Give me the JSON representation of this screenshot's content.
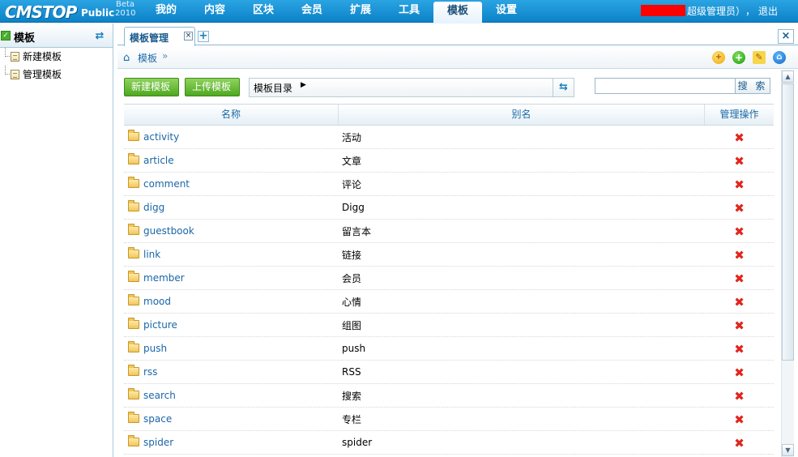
{
  "app": {
    "logo_text": "CMSTOP",
    "logo_edition": "Public",
    "logo_beta": "Beta",
    "logo_year": "2010"
  },
  "nav": {
    "tabs": [
      "我的",
      "内容",
      "区块",
      "会员",
      "扩展",
      "工具",
      "模板",
      "设置"
    ],
    "active_tab": "模板"
  },
  "user": {
    "role_text": "超级管理员）",
    "separator": "，",
    "logout_label": "退出"
  },
  "sidebar": {
    "title": "模板",
    "refresh_icon": "refresh-icon",
    "items": [
      {
        "label": "新建模板",
        "icon": "document-icon"
      },
      {
        "label": "管理模板",
        "icon": "document-icon"
      }
    ]
  },
  "tabs": {
    "active_label": "模板管理",
    "close_symbol": "×",
    "add_symbol": "+",
    "panel_close_symbol": "×"
  },
  "breadcrumb": {
    "home_icon": "home-icon",
    "label": "模板",
    "separator": "»"
  },
  "toolbar": {
    "new_label": "新建模板",
    "upload_label": "上传模板",
    "dir_label": "模板目录",
    "search_value": "",
    "search_label": "搜 索"
  },
  "table": {
    "headers": [
      "名称",
      "别名",
      "管理操作"
    ],
    "rows": [
      {
        "name": "activity",
        "alias": "活动"
      },
      {
        "name": "article",
        "alias": "文章"
      },
      {
        "name": "comment",
        "alias": "评论"
      },
      {
        "name": "digg",
        "alias": "Digg"
      },
      {
        "name": "guestbook",
        "alias": "留言本"
      },
      {
        "name": "link",
        "alias": "链接"
      },
      {
        "name": "member",
        "alias": "会员"
      },
      {
        "name": "mood",
        "alias": "心情"
      },
      {
        "name": "picture",
        "alias": "组图"
      },
      {
        "name": "push",
        "alias": "push"
      },
      {
        "name": "rss",
        "alias": "RSS"
      },
      {
        "name": "search",
        "alias": "搜索"
      },
      {
        "name": "space",
        "alias": "专栏"
      },
      {
        "name": "spider",
        "alias": "spider"
      }
    ],
    "delete_symbol": "✖"
  },
  "colors": {
    "topbar": "#1a93d6",
    "accent_green": "#4ea81f",
    "link_blue": "#1a66a8",
    "delete_red": "#e0261d"
  }
}
